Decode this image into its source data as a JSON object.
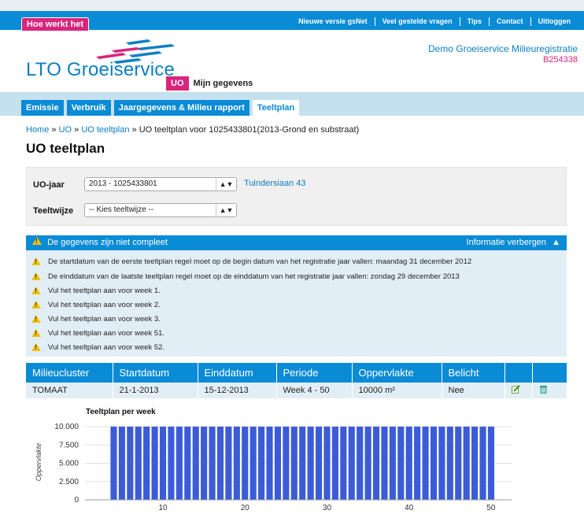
{
  "top_bar": {
    "help_tab": "Hoe werkt het",
    "links": [
      "Nieuwe versie gsNet",
      "Veel gestelde vragen",
      "Tips",
      "Contact",
      "Uitloggen"
    ]
  },
  "header": {
    "logo_text": "LTO Groeiservice",
    "org_name": "Demo Groeiservice Milieuregistratie",
    "org_code": "B254338"
  },
  "subnav": {
    "uo": "UO",
    "my_data": "Mijn gegevens"
  },
  "main_nav": {
    "tabs": [
      "Emissie",
      "Verbruik",
      "Jaargegevens & Milieu rapport",
      "Teeltplan"
    ],
    "active": "Teeltplan"
  },
  "breadcrumb": {
    "home": "Home",
    "sep": " » ",
    "uo": "UO",
    "teeltplan": "UO teeltplan",
    "current": "UO teeltplan voor 1025433801(2013-Grond en substraat)"
  },
  "page_title": "UO teeltplan",
  "filters": {
    "year_label": "UO-jaar",
    "year_value": "2013 - 1025433801",
    "address_link": "Tuindersiaan 43",
    "method_label": "Teeltwijze",
    "method_value": "-- Kies teeltwijze --"
  },
  "warnings": {
    "title": "De gegevens zijn niet compleet",
    "toggle": "Informatie verbergen",
    "items": [
      "De startdatum van de eerste teeltplan regel moet op de begin datum van het registratie jaar vallen: maandag 31 december 2012",
      "De einddatum van de laatste teeltplan regel moet op de einddatum van het registratie jaar vallen: zondag 29 december 2013",
      "Vul het teeltplan aan voor week 1.",
      "Vul het teeltplan aan voor week 2.",
      "Vul het teeltplan aan voor week 3.",
      "Vul het teeltplan aan voor week 51.",
      "Vul het teeltplan aan voor week 52."
    ]
  },
  "table": {
    "headers": [
      "Milieucluster",
      "Startdatum",
      "Einddatum",
      "Periode",
      "Oppervlakte",
      "Belicht",
      "",
      ""
    ],
    "rows": [
      {
        "cluster": "TOMAAT",
        "start": "21-1-2013",
        "end": "15-12-2013",
        "period": "Week 4 - 50",
        "area": "10000 m²",
        "lit": "Nee"
      }
    ]
  },
  "colors": {
    "brand_blue": "#0a8bd6",
    "brand_pink": "#d8257d",
    "bar_blue": "#3b5cd6"
  },
  "chart_data": {
    "type": "bar",
    "title": "Teeltplan per week",
    "ylabel": "Oppervlakte",
    "xlabel": "",
    "ylim": [
      0,
      10000
    ],
    "xlim": [
      1,
      52
    ],
    "yticks": [
      "0",
      "2.500",
      "5.000",
      "7.500",
      "10.000"
    ],
    "xticks": [
      "10",
      "20",
      "30",
      "40",
      "50"
    ],
    "x": [
      4,
      5,
      6,
      7,
      8,
      9,
      10,
      11,
      12,
      13,
      14,
      15,
      16,
      17,
      18,
      19,
      20,
      21,
      22,
      23,
      24,
      25,
      26,
      27,
      28,
      29,
      30,
      31,
      32,
      33,
      34,
      35,
      36,
      37,
      38,
      39,
      40,
      41,
      42,
      43,
      44,
      45,
      46,
      47,
      48,
      49,
      50
    ],
    "values": [
      10000,
      10000,
      10000,
      10000,
      10000,
      10000,
      10000,
      10000,
      10000,
      10000,
      10000,
      10000,
      10000,
      10000,
      10000,
      10000,
      10000,
      10000,
      10000,
      10000,
      10000,
      10000,
      10000,
      10000,
      10000,
      10000,
      10000,
      10000,
      10000,
      10000,
      10000,
      10000,
      10000,
      10000,
      10000,
      10000,
      10000,
      10000,
      10000,
      10000,
      10000,
      10000,
      10000,
      10000,
      10000,
      10000,
      10000
    ]
  }
}
